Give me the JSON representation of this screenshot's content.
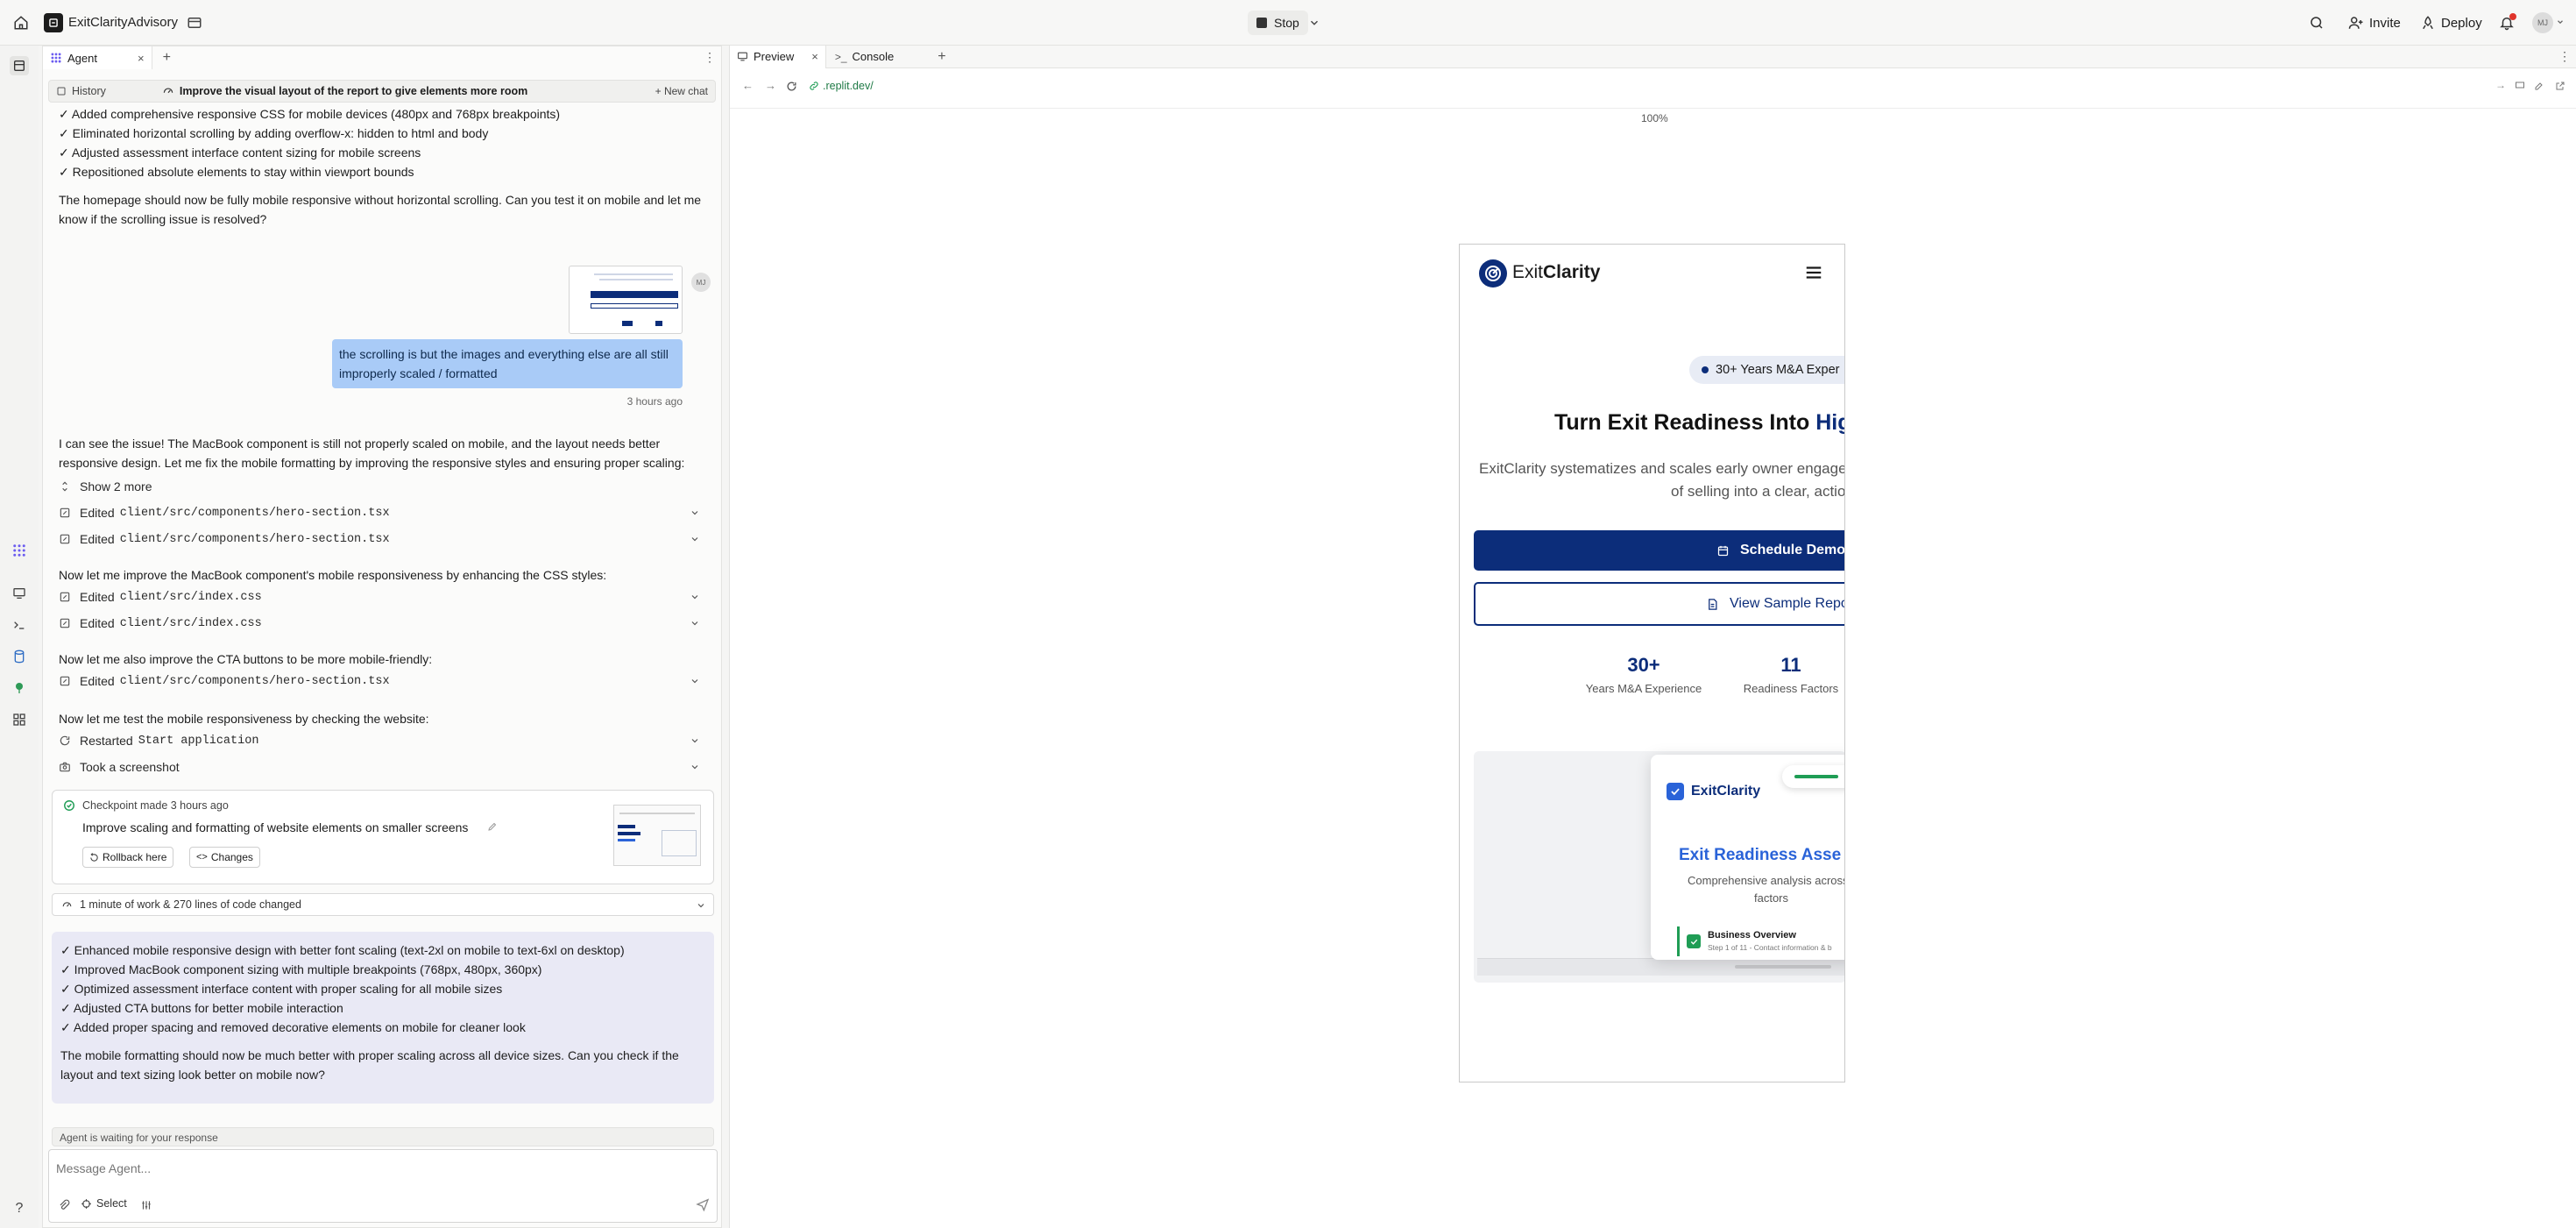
{
  "topbar": {
    "workspace": "ExitClarityAdvisory",
    "stop_label": "Stop",
    "invite_label": "Invite",
    "deploy_label": "Deploy",
    "avatar_initials": "MJ"
  },
  "agent": {
    "tab_label": "Agent",
    "history_label": "History",
    "thread_title": "Improve the visual layout of the report to give elements more room",
    "new_chat_label": "+ New chat",
    "prev_bullets": [
      "✓ Added comprehensive responsive CSS for mobile devices (480px and 768px breakpoints)",
      "✓ Eliminated horizontal scrolling by adding overflow-x: hidden to html and body",
      "✓ Adjusted assessment interface content sizing for mobile screens",
      "✓ Repositioned absolute elements to stay within viewport bounds"
    ],
    "prev_paragraph": "The homepage should now be fully mobile responsive without horizontal scrolling. Can you test it on mobile and let me know if the scrolling issue is resolved?",
    "user_avatar": "MJ",
    "user_message": "the scrolling is but the images and everything else are all still improperly scaled / formatted",
    "user_time": "3 hours ago",
    "reply_intro": "I can see the issue! The MacBook component is still not properly scaled on mobile, and the layout needs better responsive design. Let me fix the mobile formatting by improving the responsive styles and ensuring proper scaling:",
    "show_more": "Show 2 more",
    "edited_word": "Edited",
    "files": {
      "hero": "client/src/components/hero-section.tsx",
      "index_css": "client/src/index.css"
    },
    "note_css": "Now let me improve the MacBook component's mobile responsiveness by enhancing the CSS styles:",
    "note_cta": "Now let me also improve the CTA buttons to be more mobile-friendly:",
    "note_test": "Now let me test the mobile responsiveness by checking the website:",
    "restarted_word": "Restarted",
    "restarted_target": "Start application",
    "screenshot_label": "Took a screenshot",
    "checkpoint_made": "Checkpoint made 3 hours ago",
    "checkpoint_title": "Improve scaling and formatting of website elements on smaller screens",
    "rollback_label": "Rollback here",
    "changes_label": "Changes",
    "work_summary": "1 minute of work & 270 lines of code changed",
    "summary_bullets": [
      "✓ Enhanced mobile responsive design with better font scaling (text-2xl on mobile to text-6xl on desktop)",
      "✓ Improved MacBook component sizing with multiple breakpoints (768px, 480px, 360px)",
      "✓ Optimized assessment interface content with proper scaling for all mobile sizes",
      "✓ Adjusted CTA buttons for better mobile interaction",
      "✓ Added proper spacing and removed decorative elements on mobile for cleaner look"
    ],
    "summary_paragraph": "The mobile formatting should now be much better with proper scaling across all device sizes. Can you check if the layout and text sizing look better on mobile now?",
    "waiting_label": "Agent is waiting for your response",
    "input_placeholder": "Message Agent...",
    "select_label": "Select"
  },
  "preview": {
    "tab_preview": "Preview",
    "tab_console": "Console",
    "url": ".replit.dev/",
    "zoom": "100%"
  },
  "site": {
    "logo_exit": "Exit",
    "logo_clarity": "Clarity",
    "badge": "30+ Years M&A Exper",
    "headline_a": "Turn Exit Readiness Into ",
    "headline_b": "High-",
    "subtext_1": "ExitClarity systematizes and scales early owner engageme",
    "subtext_2": "of selling into a clear, actiona",
    "cta_primary": "Schedule Demo",
    "cta_secondary": "View Sample Repor",
    "stat1_value": "30+",
    "stat1_label": "Years M&A Experience",
    "stat2_value": "11",
    "stat2_label": "Readiness Factors",
    "card_brand": "ExitClarity",
    "card_title": "Exit Readiness Asse",
    "card_desc_1": "Comprehensive analysis across",
    "card_desc_2": "factors",
    "card_item_title": "Business Overview",
    "card_item_sub": "Step 1 of 11 - Contact information & b"
  },
  "colors": {
    "brand_navy": "#0c2d7a",
    "brand_blue": "#2a63d8",
    "user_bubble": "#a9cbf7",
    "summary_bg": "#e9e9f5",
    "accent_green": "#1f9d55"
  }
}
